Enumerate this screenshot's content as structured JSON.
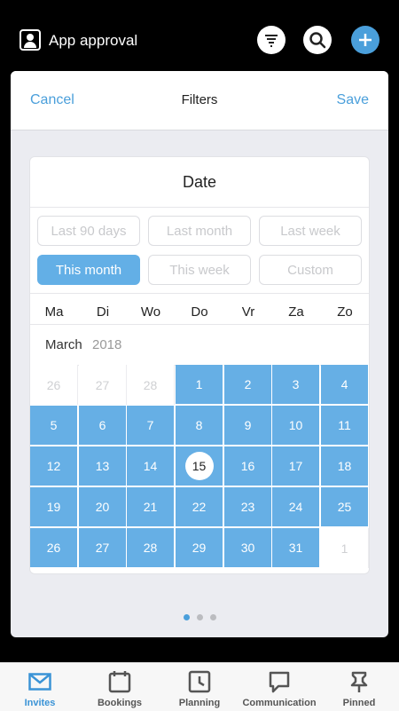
{
  "app": {
    "title": "App approval"
  },
  "toolbar": {
    "filter_icon": "filter-icon",
    "search_icon": "search-icon",
    "add_icon": "plus-icon"
  },
  "modal": {
    "cancel": "Cancel",
    "title": "Filters",
    "save": "Save"
  },
  "date_card": {
    "title": "Date",
    "presets": [
      "Last 90 days",
      "Last month",
      "Last week",
      "This month",
      "This week",
      "Custom"
    ],
    "active_preset": "This month"
  },
  "calendar": {
    "weekdays": [
      "Ma",
      "Di",
      "Wo",
      "Do",
      "Vr",
      "Za",
      "Zo"
    ],
    "month": "March",
    "year": "2018",
    "today": "15",
    "weeks": [
      [
        "26",
        "27",
        "28",
        "1",
        "2",
        "3",
        "4"
      ],
      [
        "5",
        "6",
        "7",
        "8",
        "9",
        "10",
        "11"
      ],
      [
        "12",
        "13",
        "14",
        "15",
        "16",
        "17",
        "18"
      ],
      [
        "19",
        "20",
        "21",
        "22",
        "23",
        "24",
        "25"
      ],
      [
        "26",
        "27",
        "28",
        "29",
        "30",
        "31",
        "1"
      ]
    ],
    "out_of_month": [
      [
        0,
        0
      ],
      [
        0,
        1
      ],
      [
        0,
        2
      ],
      [
        4,
        6
      ]
    ]
  },
  "pager": {
    "count": 3,
    "active": 0
  },
  "tabs": [
    {
      "label": "Invites",
      "icon": "envelope-icon",
      "active": true
    },
    {
      "label": "Bookings",
      "icon": "calendar-icon",
      "active": false
    },
    {
      "label": "Planning",
      "icon": "clock-icon",
      "active": false
    },
    {
      "label": "Communication",
      "icon": "chat-icon",
      "active": false
    },
    {
      "label": "Pinned",
      "icon": "pin-icon",
      "active": false
    }
  ],
  "colors": {
    "accent": "#4a9fdb",
    "selected": "#66afe5"
  }
}
